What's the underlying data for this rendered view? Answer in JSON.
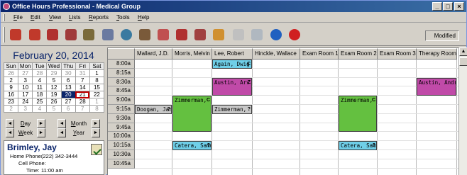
{
  "window": {
    "title": "Office Hours Professional - Medical Group",
    "buttons": {
      "minimize": "_",
      "maximize": "□",
      "close": "×"
    }
  },
  "menu": [
    "File",
    "Edit",
    "View",
    "Lists",
    "Reports",
    "Tools",
    "Help"
  ],
  "toolbar": {
    "icons": [
      {
        "name": "new-appointment-icon",
        "color": "#c0392b"
      },
      {
        "name": "edit-appointment-icon",
        "color": "#c0392b"
      },
      {
        "name": "delete-appointment-icon",
        "color": "#b03030"
      },
      {
        "name": "patient-icon",
        "color": "#a03a3a"
      },
      {
        "name": "patients-list-icon",
        "color": "#7a6a3a"
      },
      {
        "name": "person-icon",
        "color": "#6a7aa0"
      },
      {
        "name": "globe-icon",
        "color": "#3a7aa0"
      },
      {
        "name": "group-icon",
        "color": "#7a5a3a"
      },
      {
        "name": "calendar-icon",
        "color": "#c05050"
      },
      {
        "name": "move-icon",
        "color": "#b03030"
      },
      {
        "name": "copy-icon",
        "color": "#a04040"
      },
      {
        "name": "find-icon",
        "color": "#d09030"
      },
      {
        "name": "document-icon",
        "color": "#c0c0c0"
      },
      {
        "name": "report-icon",
        "color": "#b0b8c0"
      },
      {
        "name": "help-icon",
        "color": "#2060c0"
      },
      {
        "name": "cancel-icon",
        "color": "#d02020"
      }
    ],
    "status": "Modified"
  },
  "calendar": {
    "month_title": "February 20, 2014",
    "weekdays": [
      "Sun",
      "Mon",
      "Tue",
      "Wed",
      "Thu",
      "Fri",
      "Sat"
    ],
    "weeks": [
      [
        "26",
        "27",
        "28",
        "29",
        "30",
        "31",
        "1"
      ],
      [
        "2",
        "3",
        "4",
        "5",
        "6",
        "7",
        "8"
      ],
      [
        "9",
        "10",
        "11",
        "12",
        "13",
        "14",
        "15"
      ],
      [
        "16",
        "17",
        "18",
        "19",
        "20",
        "21",
        "22"
      ],
      [
        "23",
        "24",
        "25",
        "26",
        "27",
        "28",
        "1"
      ],
      [
        "2",
        "3",
        "4",
        "5",
        "6",
        "7",
        "8"
      ]
    ],
    "today": "20",
    "selected": "21"
  },
  "navigation": {
    "day": "Day",
    "week": "Week",
    "month": "Month",
    "year": "Year",
    "prev": "◄",
    "next": "►"
  },
  "contact": {
    "name": "Brimley, Jay",
    "home_phone_label": "Home Phone:",
    "home_phone": "(222) 342-3444",
    "cell_phone_label": "Cell Phone:",
    "cell_phone": "",
    "time_label": "Time:",
    "time": "11:00 am"
  },
  "schedule": {
    "columns": [
      "Mallard, J.D.",
      "Morris, Melvin",
      "Lee, Robert",
      "Hinckle, Wallace",
      "Exam Room 1",
      "Exam Room 2",
      "Exam Room 3",
      "Therapy Room"
    ],
    "times": [
      "8:00a",
      "8:15a",
      "8:30a",
      "8:45a",
      "9:00a",
      "9:15a",
      "9:30a",
      "9:45a",
      "10:00a",
      "10:15a",
      "10:30a",
      "10:45a"
    ],
    "appointments": [
      {
        "text": "Again, Dwig",
        "flag": "C",
        "color": "#6fcfe8"
      },
      {
        "text": "Austin, Arv",
        "flag": "Z",
        "color": "#c04aa8"
      },
      {
        "text": "Austin, Andr",
        "flag": "",
        "color": "#c04aa8"
      },
      {
        "text": "Zimmerman,",
        "flag": "C",
        "color": "#64c040"
      },
      {
        "text": "Zimmerman,",
        "flag": "C",
        "color": "#64c040"
      },
      {
        "text": "Doogan, Jar",
        "flag": "?",
        "color": "#c8c8c8"
      },
      {
        "text": "Zimmerman,",
        "flag": "?",
        "color": "#c8c8c8"
      },
      {
        "text": "Catera, Samu",
        "flag": "?",
        "color": "#6fcfe8"
      },
      {
        "text": "Catera, Samu",
        "flag": "?",
        "color": "#6fcfe8"
      }
    ]
  }
}
